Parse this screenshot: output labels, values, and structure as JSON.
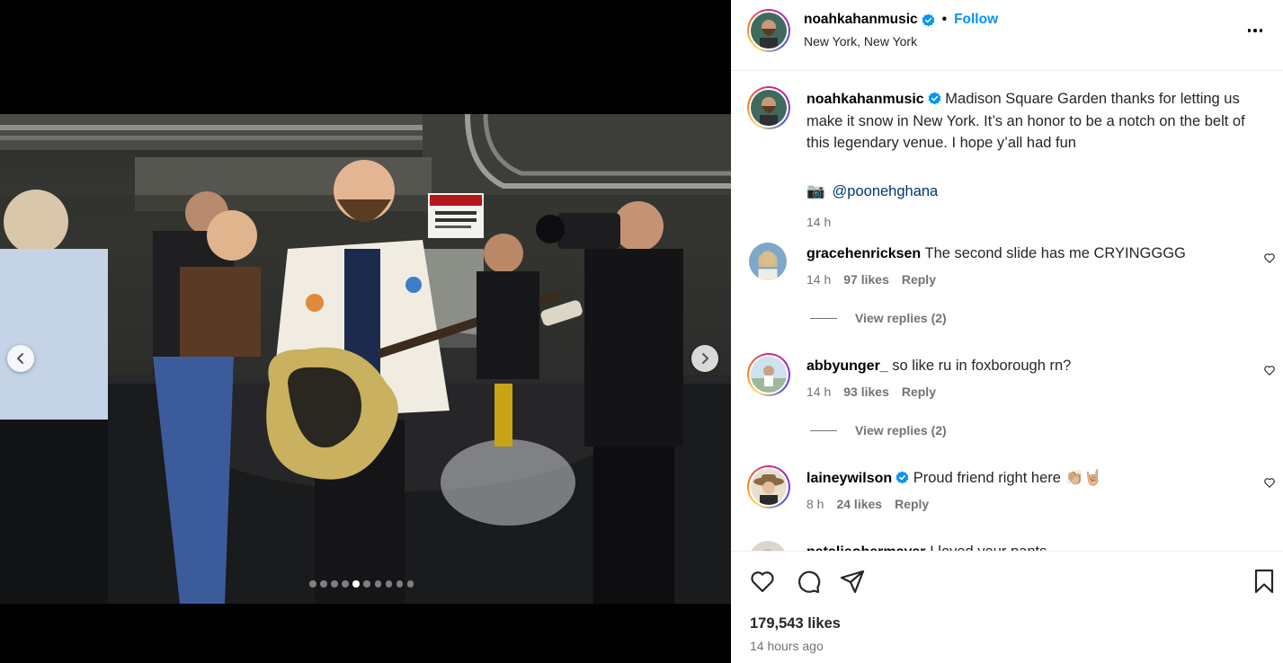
{
  "post": {
    "author": "noahkahanmusic",
    "verified": true,
    "follow_label": "Follow",
    "separator": "•",
    "location": "New York, New York",
    "more_icon": "more-options-icon",
    "carousel": {
      "total_slides": 10,
      "active_index": 4
    }
  },
  "caption": {
    "username": "noahkahanmusic",
    "text": "Madison Square Garden thanks for letting us make it snow in New York. It’s an honor to be a notch on the belt of this legendary venue. I hope y’all had fun",
    "camera_emoji": "📷",
    "credit": "@poonehghana",
    "time": "14 h"
  },
  "comments": [
    {
      "username": "gracehenricksen",
      "verified": false,
      "text": "The second slide has me CRYINGGGG",
      "time": "14 h",
      "likes": "97 likes",
      "reply_label": "Reply",
      "view_replies": "View replies (2)"
    },
    {
      "username": "abbyunger_",
      "verified": false,
      "text": "so like ru in foxborough rn?",
      "time": "14 h",
      "likes": "93 likes",
      "reply_label": "Reply",
      "view_replies": "View replies (2)"
    },
    {
      "username": "laineywilson",
      "verified": true,
      "text": "Proud friend right here 👏🏼🤘🏼",
      "time": "8 h",
      "likes": "24 likes",
      "reply_label": "Reply"
    },
    {
      "username": "natalieohermayer",
      "verified": false,
      "text": "I loved your pants"
    }
  ],
  "footer": {
    "likes": "179,543 likes",
    "time_ago": "14 hours ago"
  },
  "colors": {
    "link": "#0095f6",
    "secondary_text": "#737373",
    "mention": "#00376b",
    "verified": "#0095f6"
  }
}
